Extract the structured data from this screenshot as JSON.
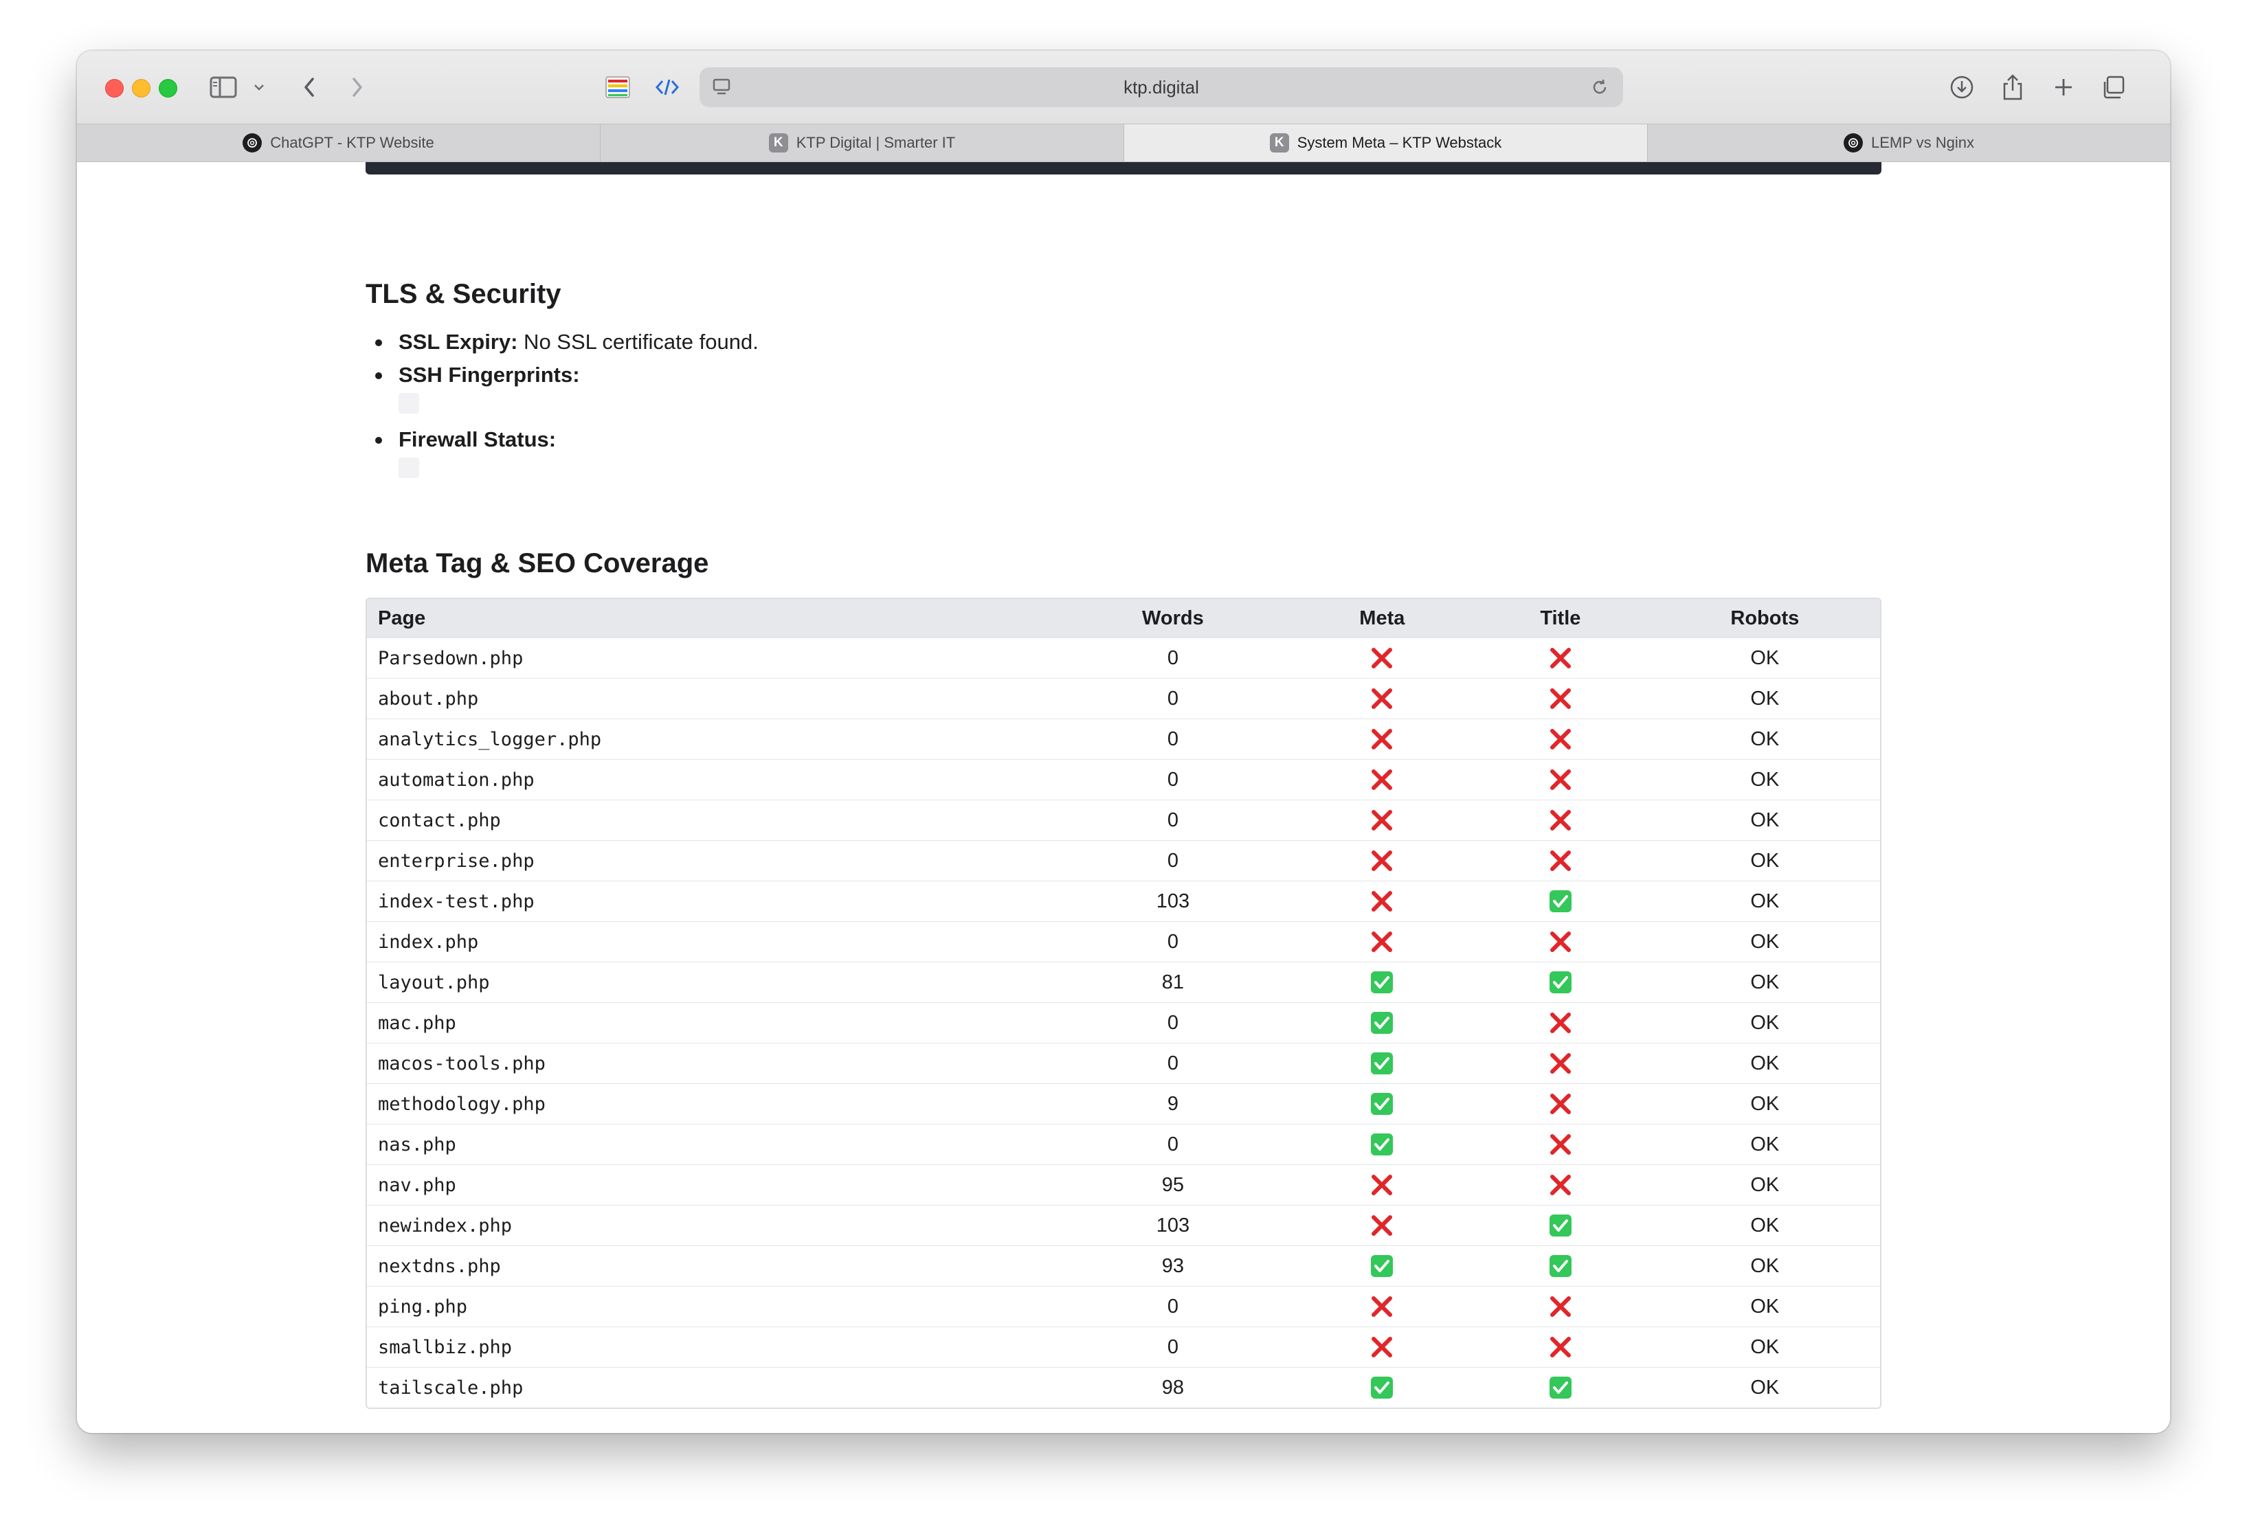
{
  "browser": {
    "url": "ktp.digital",
    "tabs": [
      {
        "label": "ChatGPT - KTP Website",
        "favicon": "chatgpt-icon",
        "active": false
      },
      {
        "label": "KTP Digital | Smarter IT",
        "favicon": "k-icon",
        "active": false
      },
      {
        "label": "System Meta – KTP Webstack",
        "favicon": "k-icon",
        "active": true
      },
      {
        "label": "LEMP vs Nginx",
        "favicon": "chatgpt-icon",
        "active": false
      }
    ]
  },
  "tls": {
    "heading": "TLS & Security",
    "ssl_label": "SSL Expiry:",
    "ssl_value": " No SSL certificate found.",
    "ssh_label": "SSH Fingerprints:",
    "firewall_label": "Firewall Status:"
  },
  "seo": {
    "heading": "Meta Tag & SEO Coverage",
    "columns": [
      "Page",
      "Words",
      "Meta",
      "Title",
      "Robots"
    ],
    "rows": [
      {
        "page": "Parsedown.php",
        "words": "0",
        "meta": false,
        "title": false,
        "robots": "OK"
      },
      {
        "page": "about.php",
        "words": "0",
        "meta": false,
        "title": false,
        "robots": "OK"
      },
      {
        "page": "analytics_logger.php",
        "words": "0",
        "meta": false,
        "title": false,
        "robots": "OK"
      },
      {
        "page": "automation.php",
        "words": "0",
        "meta": false,
        "title": false,
        "robots": "OK"
      },
      {
        "page": "contact.php",
        "words": "0",
        "meta": false,
        "title": false,
        "robots": "OK"
      },
      {
        "page": "enterprise.php",
        "words": "0",
        "meta": false,
        "title": false,
        "robots": "OK"
      },
      {
        "page": "index-test.php",
        "words": "103",
        "meta": false,
        "title": true,
        "robots": "OK"
      },
      {
        "page": "index.php",
        "words": "0",
        "meta": false,
        "title": false,
        "robots": "OK"
      },
      {
        "page": "layout.php",
        "words": "81",
        "meta": true,
        "title": true,
        "robots": "OK"
      },
      {
        "page": "mac.php",
        "words": "0",
        "meta": true,
        "title": false,
        "robots": "OK"
      },
      {
        "page": "macos-tools.php",
        "words": "0",
        "meta": true,
        "title": false,
        "robots": "OK"
      },
      {
        "page": "methodology.php",
        "words": "9",
        "meta": true,
        "title": false,
        "robots": "OK"
      },
      {
        "page": "nas.php",
        "words": "0",
        "meta": true,
        "title": false,
        "robots": "OK"
      },
      {
        "page": "nav.php",
        "words": "95",
        "meta": false,
        "title": false,
        "robots": "OK"
      },
      {
        "page": "newindex.php",
        "words": "103",
        "meta": false,
        "title": true,
        "robots": "OK"
      },
      {
        "page": "nextdns.php",
        "words": "93",
        "meta": true,
        "title": true,
        "robots": "OK"
      },
      {
        "page": "ping.php",
        "words": "0",
        "meta": false,
        "title": false,
        "robots": "OK"
      },
      {
        "page": "smallbiz.php",
        "words": "0",
        "meta": false,
        "title": false,
        "robots": "OK"
      },
      {
        "page": "tailscale.php",
        "words": "98",
        "meta": true,
        "title": true,
        "robots": "OK"
      }
    ]
  },
  "colors": {
    "check": "#34c759",
    "cross": "#e0262a",
    "dark_bar": "#262a33"
  }
}
